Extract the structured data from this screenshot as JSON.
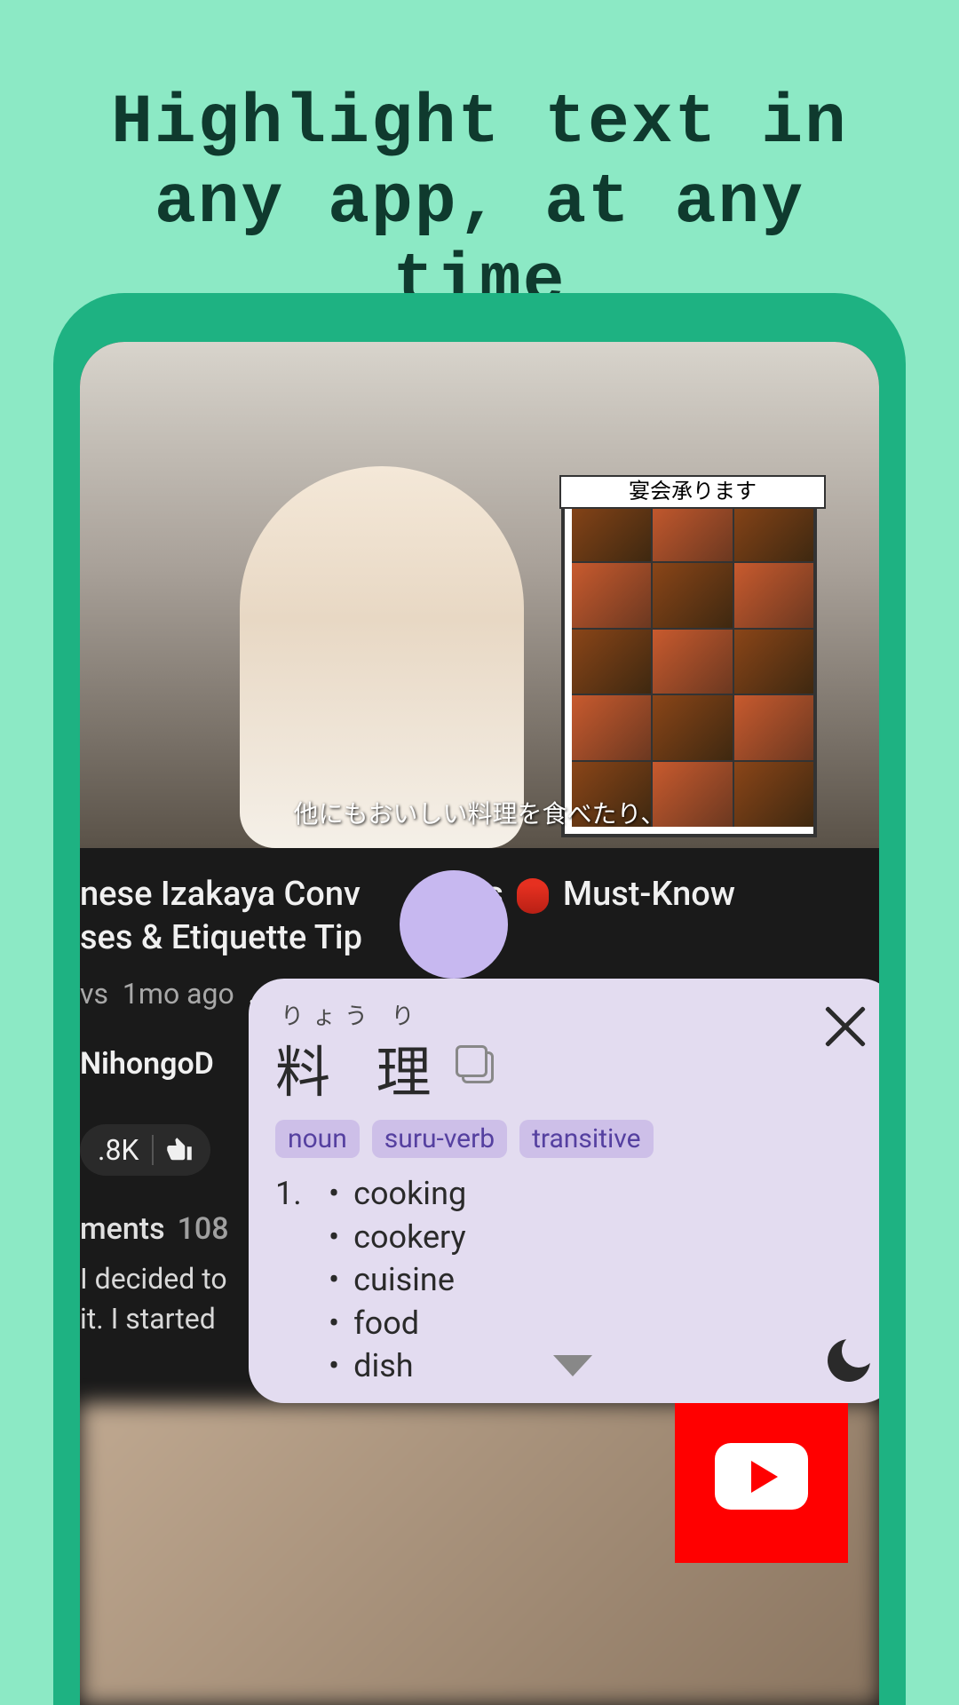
{
  "headline": "Highlight text in any app, at any time",
  "video": {
    "sign_banner": "宴会承ります",
    "subtitle": "他にもおいしい料理を食べたり、",
    "title_prefix": "nese Izakaya Conv",
    "title_middle": "tions",
    "title_suffix": "Must-Know",
    "title_line2": "ses & Etiquette Tip",
    "meta_prefix": "vs",
    "meta_age": "1mo ago",
    "meta_more": "...more",
    "channel": "NihongoD",
    "like_count": ".8K",
    "comments_label": "ments",
    "comments_count": "108",
    "comment_line1": "I decided to",
    "comment_line2": "it. I started"
  },
  "popup": {
    "reading": "りょう り",
    "headword": "料 理",
    "tags": [
      "noun",
      "suru-verb",
      "transitive"
    ],
    "def_num": "1.",
    "definitions": [
      "cooking",
      "cookery",
      "cuisine",
      "food",
      "dish"
    ]
  },
  "icons": {
    "close": "close",
    "copy": "copy",
    "expand": "expand",
    "moon": "dark-mode",
    "youtube": "youtube"
  }
}
